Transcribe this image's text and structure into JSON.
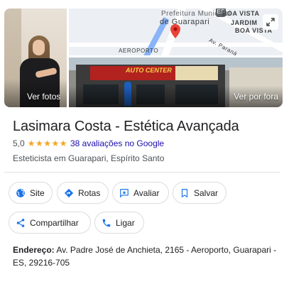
{
  "photos": {
    "main_label": "Ver fotos",
    "street_label": "Ver por fora",
    "map": {
      "line1": "Prefeitura Municipal",
      "line2": "de Guarapari",
      "poi_top": "BOA VISTA",
      "poi_mid": "JARDIM",
      "poi_bottom": "BOA VISTA",
      "district": "AEROPORTO",
      "street": "Av. Paraná",
      "shield": "ES"
    },
    "storefront_sign": "AUTO CENTER"
  },
  "business": {
    "name": "Lasimara Costa - Estética Avançada",
    "rating": "5,0",
    "stars": "★★★★★",
    "reviews_link": "38 avaliações no Google",
    "category": "Esteticista em Guarapari, Espírito Santo"
  },
  "actions": {
    "site": "Site",
    "rotas": "Rotas",
    "avaliar": "Avaliar",
    "salvar": "Salvar",
    "compartilhar": "Compartilhar",
    "ligar": "Ligar"
  },
  "address": {
    "label": "Endereço:",
    "value": " Av. Padre José de Anchieta, 2165 - Aeroporto, Guarapari - ES, 29216-705"
  },
  "colors": {
    "accent_blue": "#1a73e8",
    "link_blue": "#1a0dab",
    "star_yellow": "#f5a623",
    "map_pin_red": "#ea4335"
  },
  "icons": {
    "site": "globe-icon",
    "rotas": "directions-icon",
    "avaliar": "review-icon",
    "salvar": "bookmark-icon",
    "compartilhar": "share-icon",
    "ligar": "phone-icon",
    "map": "map-pin-icon",
    "expand": "expand-icon"
  }
}
